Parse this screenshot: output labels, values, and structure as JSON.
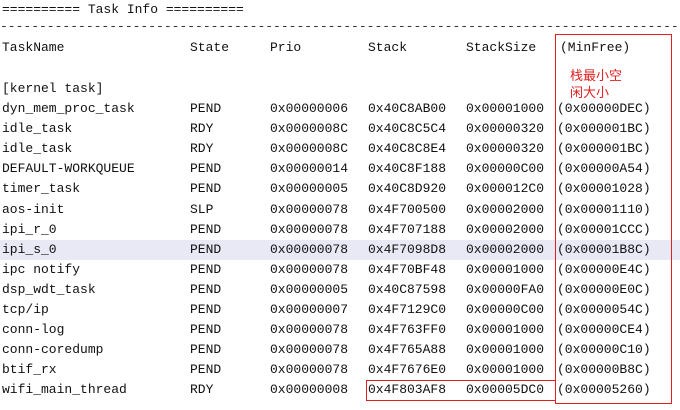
{
  "title_line": "========== Task Info ==========",
  "separator": "-------------------------------------------------------------------------------------------------",
  "headers": {
    "taskname": "TaskName",
    "state": "State",
    "prio": "Prio",
    "stack": "Stack",
    "stacksize": "StackSize",
    "minfree": "(MinFree)"
  },
  "kernel_label": "[kernel task]",
  "annotation": {
    "line1": "栈最小空",
    "line2": "闲大小"
  },
  "colors": {
    "highlight_row": "#e9e9f6",
    "annotation_red": "#e02020"
  },
  "highlighted_task": "ipi_s_0",
  "rows": [
    {
      "name": "dyn_mem_proc_task",
      "state": "PEND",
      "prio": "0x00000006",
      "stack": "0x40C8AB00",
      "stacksize": "0x00001000",
      "minfree": "(0x00000DEC)"
    },
    {
      "name": "idle_task",
      "state": "RDY",
      "prio": "0x0000008C",
      "stack": "0x40C8C5C4",
      "stacksize": "0x00000320",
      "minfree": "(0x000001BC)"
    },
    {
      "name": "idle_task",
      "state": "RDY",
      "prio": "0x0000008C",
      "stack": "0x40C8C8E4",
      "stacksize": "0x00000320",
      "minfree": "(0x000001BC)"
    },
    {
      "name": "DEFAULT-WORKQUEUE",
      "state": "PEND",
      "prio": "0x00000014",
      "stack": "0x40C8F188",
      "stacksize": "0x00000C00",
      "minfree": "(0x00000A54)"
    },
    {
      "name": "timer_task",
      "state": "PEND",
      "prio": "0x00000005",
      "stack": "0x40C8D920",
      "stacksize": "0x000012C0",
      "minfree": "(0x00001028)"
    },
    {
      "name": "aos-init",
      "state": "SLP",
      "prio": "0x00000078",
      "stack": "0x4F700500",
      "stacksize": "0x00002000",
      "minfree": "(0x00001110)"
    },
    {
      "name": "ipi_r_0",
      "state": "PEND",
      "prio": "0x00000078",
      "stack": "0x4F707188",
      "stacksize": "0x00002000",
      "minfree": "(0x00001CCC)"
    },
    {
      "name": "ipi_s_0",
      "state": "PEND",
      "prio": "0x00000078",
      "stack": "0x4F7098D8",
      "stacksize": "0x00002000",
      "minfree": "(0x00001B8C)"
    },
    {
      "name": "ipc notify",
      "state": "PEND",
      "prio": "0x00000078",
      "stack": "0x4F70BF48",
      "stacksize": "0x00001000",
      "minfree": "(0x00000E4C)"
    },
    {
      "name": "dsp_wdt_task",
      "state": "PEND",
      "prio": "0x00000005",
      "stack": "0x40C87598",
      "stacksize": "0x00000FA0",
      "minfree": "(0x00000E0C)"
    },
    {
      "name": "tcp/ip",
      "state": "PEND",
      "prio": "0x00000007",
      "stack": "0x4F7129C0",
      "stacksize": "0x00000C00",
      "minfree": "(0x0000054C)"
    },
    {
      "name": "conn-log",
      "state": "PEND",
      "prio": "0x00000078",
      "stack": "0x4F763FF0",
      "stacksize": "0x00001000",
      "minfree": "(0x00000CE4)"
    },
    {
      "name": "conn-coredump",
      "state": "PEND",
      "prio": "0x00000078",
      "stack": "0x4F765A88",
      "stacksize": "0x00001000",
      "minfree": "(0x00000C10)"
    },
    {
      "name": "btif_rx",
      "state": "PEND",
      "prio": "0x00000078",
      "stack": "0x4F7676E0",
      "stacksize": "0x00001000",
      "minfree": "(0x00000B8C)"
    },
    {
      "name": "wifi_main_thread",
      "state": "RDY",
      "prio": "0x00000008",
      "stack": "0x4F803AF8",
      "stacksize": "0x00005DC0",
      "minfree": "(0x00005260)"
    }
  ]
}
